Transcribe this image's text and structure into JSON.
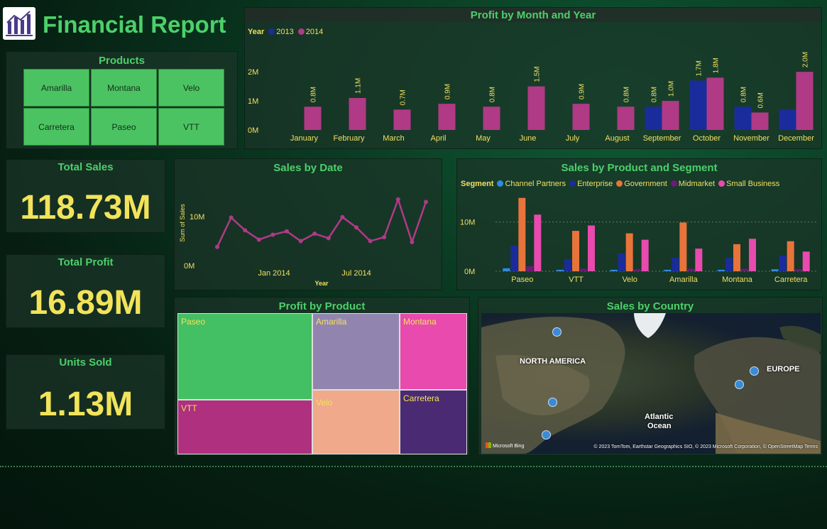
{
  "header": {
    "title": "Financial Report",
    "logo_icon": "bar-chart-icon"
  },
  "products_slicer": {
    "title": "Products",
    "items": [
      "Amarilla",
      "Montana",
      "Velo",
      "Carretera",
      "Paseo",
      "VTT"
    ]
  },
  "kpis": [
    {
      "title": "Total Sales",
      "value": "118.73M"
    },
    {
      "title": "Total Profit",
      "value": "16.89M"
    },
    {
      "title": "Units Sold",
      "value": "1.13M"
    }
  ],
  "colors": {
    "accent": "#4cd06a",
    "kpi": "#f2e35a",
    "y2013": "#1a2c9c",
    "y2014": "#b03a86",
    "line": "#b03a86"
  },
  "chart_data": [
    {
      "id": "profit_by_month",
      "type": "bar",
      "title": "Profit by Month and Year",
      "legend_title": "Year",
      "legend_position": "top-left",
      "categories": [
        "January",
        "February",
        "March",
        "April",
        "May",
        "June",
        "July",
        "August",
        "September",
        "October",
        "November",
        "December"
      ],
      "series": [
        {
          "name": "2013",
          "color": "#1a2c9c",
          "values": [
            null,
            null,
            null,
            null,
            null,
            null,
            null,
            null,
            0.8,
            1.7,
            0.8,
            0.7
          ],
          "labels": [
            "",
            "",
            "",
            "",
            "",
            "",
            "",
            "",
            "0.8M",
            "1.7M",
            "0.8M",
            ""
          ]
        },
        {
          "name": "2014",
          "color": "#b03a86",
          "values": [
            0.8,
            1.1,
            0.7,
            0.9,
            0.8,
            1.5,
            0.9,
            0.8,
            1.0,
            1.8,
            0.6,
            2.0
          ],
          "labels": [
            "0.8M",
            "1.1M",
            "0.7M",
            "0.9M",
            "0.8M",
            "1.5M",
            "0.9M",
            "0.8M",
            "1.0M",
            "1.8M",
            "0.6M",
            "2.0M"
          ]
        }
      ],
      "y_ticks": [
        "0M",
        "1M",
        "2M"
      ],
      "ylim": [
        0,
        2.2
      ],
      "grid": false
    },
    {
      "id": "sales_by_date",
      "type": "line",
      "title": "Sales by Date",
      "xlabel": "Year",
      "ylabel": "Sum of Sales",
      "x_ticks": [
        "Jan 2014",
        "Jul 2014"
      ],
      "y_ticks": [
        "0M",
        "10M"
      ],
      "ylim": [
        0,
        14.5
      ],
      "values": [
        3.8,
        9.8,
        7.2,
        5.3,
        6.3,
        7.0,
        5.0,
        6.5,
        5.6,
        9.9,
        7.8,
        5.0,
        5.8,
        13.5,
        4.8,
        13.0
      ],
      "color": "#b03a86"
    },
    {
      "id": "sales_by_product_segment",
      "type": "bar",
      "title": "Sales by Product and Segment",
      "legend_title": "Segment",
      "legend_position": "top-left",
      "categories": [
        "Paseo",
        "VTT",
        "Velo",
        "Amarilla",
        "Montana",
        "Carretera"
      ],
      "series": [
        {
          "name": "Channel Partners",
          "color": "#2f8be0",
          "values": [
            0.6,
            0.3,
            0.3,
            0.3,
            0.3,
            0.4
          ]
        },
        {
          "name": "Enterprise",
          "color": "#1a2c9c",
          "values": [
            5.2,
            2.4,
            3.6,
            2.7,
            2.7,
            3.2
          ]
        },
        {
          "name": "Government",
          "color": "#e8743b",
          "values": [
            14.9,
            8.2,
            7.7,
            9.9,
            5.5,
            6.1
          ]
        },
        {
          "name": "Midmarket",
          "color": "#6b1a7a",
          "values": [
            1.0,
            0.5,
            0.4,
            0.5,
            0.5,
            0.4
          ]
        },
        {
          "name": "Small Business",
          "color": "#e84aae",
          "values": [
            11.5,
            9.3,
            6.4,
            4.6,
            6.6,
            4.0
          ]
        }
      ],
      "y_ticks": [
        "0M",
        "10M"
      ],
      "ylim": [
        0,
        15
      ]
    },
    {
      "id": "profit_by_product",
      "type": "treemap",
      "title": "Profit by Product",
      "items": [
        {
          "name": "Paseo",
          "color": "#43bf64"
        },
        {
          "name": "VTT",
          "color": "#ae307f"
        },
        {
          "name": "Amarilla",
          "color": "#9185b0"
        },
        {
          "name": "Velo",
          "color": "#f0a98a"
        },
        {
          "name": "Montana",
          "color": "#e84aae"
        },
        {
          "name": "Carretera",
          "color": "#4a2a72"
        }
      ]
    },
    {
      "id": "sales_by_country",
      "type": "map",
      "title": "Sales by Country",
      "labels": [
        "NORTH AMERICA",
        "EUROPE",
        "Atlantic",
        "Ocean"
      ],
      "attribution": "© 2023 TomTom, Earthstar Geographics SIO, © 2023 Microsoft Corporation, © OpenStreetMap  Terms",
      "brand": "Microsoft Bing"
    }
  ]
}
